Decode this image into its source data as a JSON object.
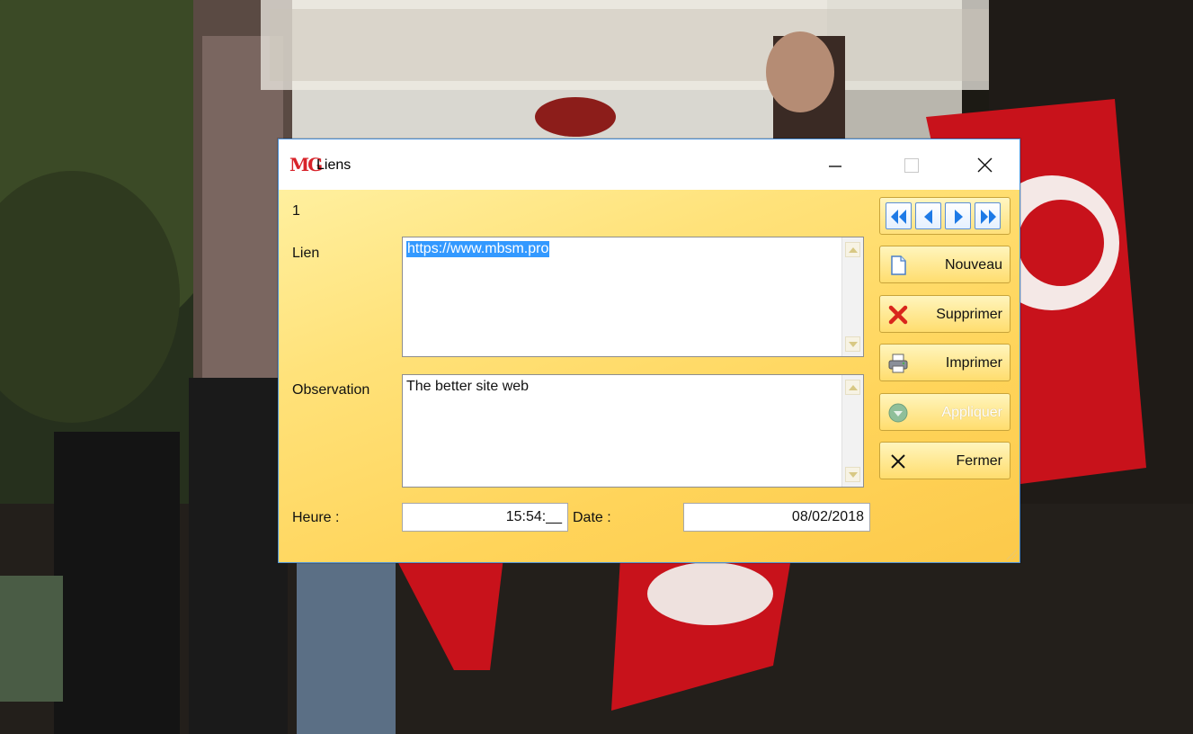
{
  "window": {
    "title": "Liens",
    "logo_text": "MG"
  },
  "form": {
    "record_number": "1",
    "lien_label": "Lien",
    "lien_value": "https://www.mbsm.pro",
    "observation_label": "Observation",
    "observation_value": "The better site web",
    "heure_label": "Heure :",
    "heure_value": "15:54:__",
    "date_label": "Date :",
    "date_value": "08/02/2018"
  },
  "buttons": {
    "nouveau": "Nouveau",
    "supprimer": "Supprimer",
    "imprimer": "Imprimer",
    "appliquer": "Appliquer",
    "fermer": "Fermer"
  },
  "icons": {
    "nav_first": "double-chevron-left-icon",
    "nav_prev": "triangle-left-icon",
    "nav_next": "triangle-right-icon",
    "nav_last": "double-chevron-right-icon",
    "nouveau": "new-document-icon",
    "supprimer": "red-x-icon",
    "imprimer": "printer-icon",
    "appliquer": "apply-check-icon",
    "fermer": "close-x-icon"
  },
  "colors": {
    "window_border": "#4a90d9",
    "form_background": "#ffd45a",
    "selection": "#3399ff",
    "logo": "#d8232a",
    "nav_arrow": "#1e7ae6"
  }
}
